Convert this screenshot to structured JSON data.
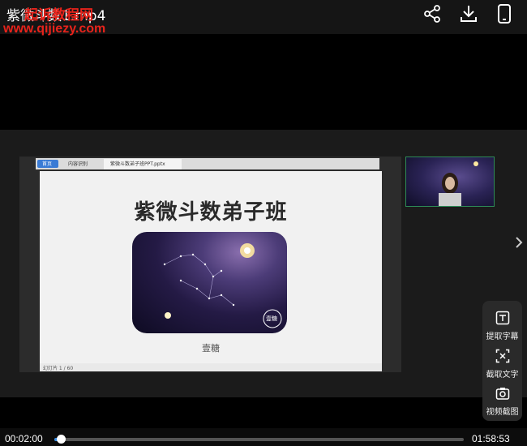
{
  "header": {
    "title": "紫微斗数1.mp4",
    "watermark_cn": "起诉教程网",
    "watermark_url": "www.qijiezy.com"
  },
  "toolbar_icons": [
    "share-icon",
    "download-icon",
    "phone-icon"
  ],
  "slide": {
    "tabs": [
      "首页",
      "内容识别",
      "紫微斗数弟子班PPT.pptx"
    ],
    "title": "紫微斗数弟子班",
    "subtitle": "壹糖",
    "seal": "壹糖",
    "page_indicator": "幻灯片 1 / 60"
  },
  "side_tools": [
    {
      "label": "提取字幕",
      "icon": "subtitle-extract-icon"
    },
    {
      "label": "截取文字",
      "icon": "text-capture-icon"
    },
    {
      "label": "视频截图",
      "icon": "camera-icon"
    }
  ],
  "player": {
    "current_time": "00:02:00",
    "total_time": "01:58:53",
    "progress": 0.017
  },
  "colors": {
    "accent": "#3a8ee6",
    "watermark": "#e8231b"
  }
}
